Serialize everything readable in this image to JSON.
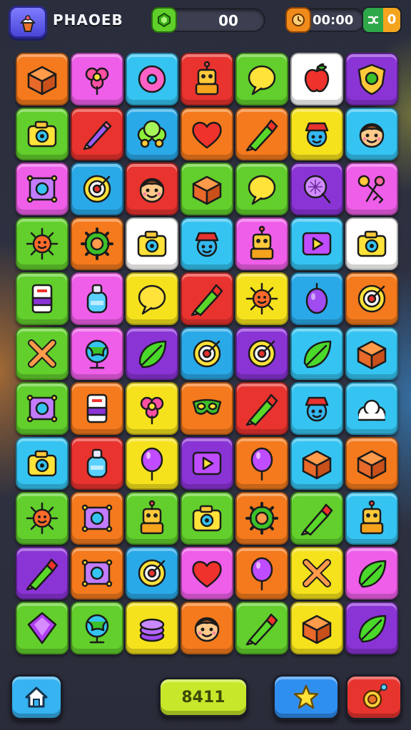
{
  "header": {
    "title": "PHAOEB",
    "gem_count": "00",
    "timer": "00:00",
    "moves": "0",
    "logo_icon": "cream-swirl-icon",
    "gem_icon": "green-gem-icon",
    "timer_icon": "clock-icon",
    "moves_icon": "shuffle-icon"
  },
  "board": {
    "rows": 11,
    "cols": 7,
    "tiles": [
      {
        "row": 0,
        "col": 0,
        "color": "#f47a1d",
        "icon": "box"
      },
      {
        "row": 0,
        "col": 1,
        "color": "#ee5ee8",
        "icon": "flower"
      },
      {
        "row": 0,
        "col": 2,
        "color": "#35c4f2",
        "icon": "donut"
      },
      {
        "row": 0,
        "col": 3,
        "color": "#e8332f",
        "icon": "robot"
      },
      {
        "row": 0,
        "col": 4,
        "color": "#62cf2c",
        "icon": "bubble"
      },
      {
        "row": 0,
        "col": 5,
        "color": "#ffffff",
        "icon": "apple"
      },
      {
        "row": 0,
        "col": 6,
        "color": "#8a34d6",
        "icon": "shield"
      },
      {
        "row": 1,
        "col": 0,
        "color": "#62cf2c",
        "icon": "camera"
      },
      {
        "row": 1,
        "col": 1,
        "color": "#e8332f",
        "icon": "pencil"
      },
      {
        "row": 1,
        "col": 2,
        "color": "#2aa9e8",
        "icon": "bush"
      },
      {
        "row": 1,
        "col": 3,
        "color": "#f47a1d",
        "icon": "heart"
      },
      {
        "row": 1,
        "col": 4,
        "color": "#f47a1d",
        "icon": "crayon"
      },
      {
        "row": 1,
        "col": 5,
        "color": "#f6e21c",
        "icon": "face-hat"
      },
      {
        "row": 1,
        "col": 6,
        "color": "#35c4f2",
        "icon": "face"
      },
      {
        "row": 2,
        "col": 0,
        "color": "#ee5ee8",
        "icon": "frame"
      },
      {
        "row": 2,
        "col": 1,
        "color": "#2aa9e8",
        "icon": "ring"
      },
      {
        "row": 2,
        "col": 2,
        "color": "#e8332f",
        "icon": "face"
      },
      {
        "row": 2,
        "col": 3,
        "color": "#62cf2c",
        "icon": "box"
      },
      {
        "row": 2,
        "col": 4,
        "color": "#62cf2c",
        "icon": "bubble"
      },
      {
        "row": 2,
        "col": 5,
        "color": "#8a34d6",
        "icon": "racket"
      },
      {
        "row": 2,
        "col": 6,
        "color": "#ee5ee8",
        "icon": "keys"
      },
      {
        "row": 3,
        "col": 0,
        "color": "#62cf2c",
        "icon": "sun"
      },
      {
        "row": 3,
        "col": 1,
        "color": "#f47a1d",
        "icon": "gear"
      },
      {
        "row": 3,
        "col": 2,
        "color": "#ffffff",
        "icon": "camera"
      },
      {
        "row": 3,
        "col": 3,
        "color": "#35c4f2",
        "icon": "face-hat"
      },
      {
        "row": 3,
        "col": 4,
        "color": "#ee5ee8",
        "icon": "robot"
      },
      {
        "row": 3,
        "col": 5,
        "color": "#35c4f2",
        "icon": "play"
      },
      {
        "row": 3,
        "col": 6,
        "color": "#ffffff",
        "icon": "camera"
      },
      {
        "row": 4,
        "col": 0,
        "color": "#62cf2c",
        "icon": "tag"
      },
      {
        "row": 4,
        "col": 1,
        "color": "#ee5ee8",
        "icon": "bottle"
      },
      {
        "row": 4,
        "col": 2,
        "color": "#f6e21c",
        "icon": "bubble"
      },
      {
        "row": 4,
        "col": 3,
        "color": "#e8332f",
        "icon": "crayon"
      },
      {
        "row": 4,
        "col": 4,
        "color": "#f6e21c",
        "icon": "sun"
      },
      {
        "row": 4,
        "col": 5,
        "color": "#2aa9e8",
        "icon": "egg"
      },
      {
        "row": 4,
        "col": 6,
        "color": "#f47a1d",
        "icon": "ring"
      },
      {
        "row": 5,
        "col": 0,
        "color": "#62cf2c",
        "icon": "cross"
      },
      {
        "row": 5,
        "col": 1,
        "color": "#ee5ee8",
        "icon": "globe"
      },
      {
        "row": 5,
        "col": 2,
        "color": "#8a34d6",
        "icon": "leaf"
      },
      {
        "row": 5,
        "col": 3,
        "color": "#2aa9e8",
        "icon": "ring"
      },
      {
        "row": 5,
        "col": 4,
        "color": "#8a34d6",
        "icon": "ring"
      },
      {
        "row": 5,
        "col": 5,
        "color": "#35c4f2",
        "icon": "leaf"
      },
      {
        "row": 5,
        "col": 6,
        "color": "#35c4f2",
        "icon": "box"
      },
      {
        "row": 6,
        "col": 0,
        "color": "#62cf2c",
        "icon": "frame"
      },
      {
        "row": 6,
        "col": 1,
        "color": "#f47a1d",
        "icon": "tag"
      },
      {
        "row": 6,
        "col": 2,
        "color": "#f6e21c",
        "icon": "flower"
      },
      {
        "row": 6,
        "col": 3,
        "color": "#f47a1d",
        "icon": "mask"
      },
      {
        "row": 6,
        "col": 4,
        "color": "#e8332f",
        "icon": "crayon"
      },
      {
        "row": 6,
        "col": 5,
        "color": "#35c4f2",
        "icon": "face-hat"
      },
      {
        "row": 6,
        "col": 6,
        "color": "#35c4f2",
        "icon": "clouds"
      },
      {
        "row": 7,
        "col": 0,
        "color": "#35c4f2",
        "icon": "camera"
      },
      {
        "row": 7,
        "col": 1,
        "color": "#e8332f",
        "icon": "bottle"
      },
      {
        "row": 7,
        "col": 2,
        "color": "#f6e21c",
        "icon": "balloon"
      },
      {
        "row": 7,
        "col": 3,
        "color": "#8a34d6",
        "icon": "play"
      },
      {
        "row": 7,
        "col": 4,
        "color": "#f47a1d",
        "icon": "balloon"
      },
      {
        "row": 7,
        "col": 5,
        "color": "#35c4f2",
        "icon": "box"
      },
      {
        "row": 7,
        "col": 6,
        "color": "#f47a1d",
        "icon": "box"
      },
      {
        "row": 8,
        "col": 0,
        "color": "#62cf2c",
        "icon": "sun"
      },
      {
        "row": 8,
        "col": 1,
        "color": "#f47a1d",
        "icon": "frame"
      },
      {
        "row": 8,
        "col": 2,
        "color": "#62cf2c",
        "icon": "robot"
      },
      {
        "row": 8,
        "col": 3,
        "color": "#62cf2c",
        "icon": "camera"
      },
      {
        "row": 8,
        "col": 4,
        "color": "#f47a1d",
        "icon": "gear"
      },
      {
        "row": 8,
        "col": 5,
        "color": "#62cf2c",
        "icon": "crayon"
      },
      {
        "row": 8,
        "col": 6,
        "color": "#35c4f2",
        "icon": "robot"
      },
      {
        "row": 9,
        "col": 0,
        "color": "#8a34d6",
        "icon": "crayon"
      },
      {
        "row": 9,
        "col": 1,
        "color": "#f47a1d",
        "icon": "frame"
      },
      {
        "row": 9,
        "col": 2,
        "color": "#2aa9e8",
        "icon": "ring"
      },
      {
        "row": 9,
        "col": 3,
        "color": "#ee5ee8",
        "icon": "heart"
      },
      {
        "row": 9,
        "col": 4,
        "color": "#f47a1d",
        "icon": "balloon"
      },
      {
        "row": 9,
        "col": 5,
        "color": "#f6e21c",
        "icon": "cross"
      },
      {
        "row": 9,
        "col": 6,
        "color": "#ee5ee8",
        "icon": "leaf"
      },
      {
        "row": 10,
        "col": 0,
        "color": "#62cf2c",
        "icon": "gem"
      },
      {
        "row": 10,
        "col": 1,
        "color": "#62cf2c",
        "icon": "globe"
      },
      {
        "row": 10,
        "col": 2,
        "color": "#f6e21c",
        "icon": "coin-stack"
      },
      {
        "row": 10,
        "col": 3,
        "color": "#f47a1d",
        "icon": "face"
      },
      {
        "row": 10,
        "col": 4,
        "color": "#62cf2c",
        "icon": "crayon"
      },
      {
        "row": 10,
        "col": 5,
        "color": "#f6e21c",
        "icon": "box"
      },
      {
        "row": 10,
        "col": 6,
        "color": "#8a34d6",
        "icon": "leaf"
      }
    ]
  },
  "footer": {
    "home_icon": "home-icon",
    "play_label": "8411",
    "star_icon": "star-icon",
    "hint_icon": "bomb-icon"
  }
}
